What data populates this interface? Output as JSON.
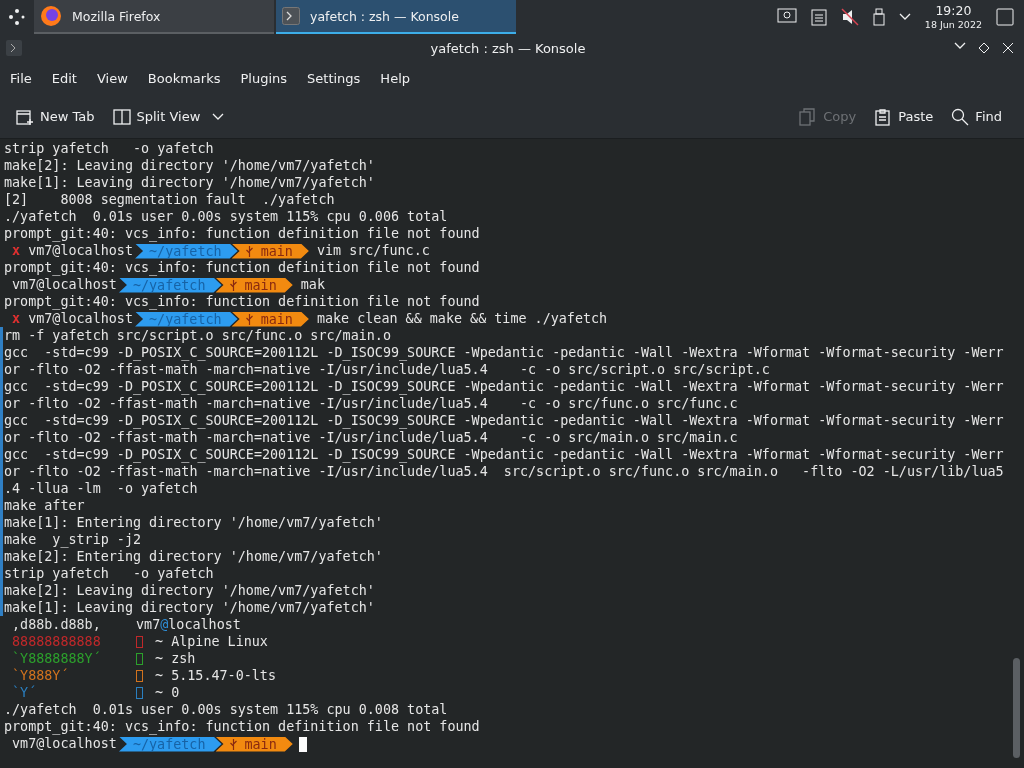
{
  "taskbar": {
    "tasks": [
      {
        "label": "Mozilla Firefox",
        "kind": "browser",
        "selected": false
      },
      {
        "label": "yafetch : zsh — Konsole",
        "kind": "terminal",
        "selected": true
      }
    ],
    "clock": {
      "time": "19:20",
      "date": "18 Jun 2022"
    }
  },
  "window": {
    "title": "yafetch : zsh — Konsole"
  },
  "menu": [
    "File",
    "Edit",
    "View",
    "Bookmarks",
    "Plugins",
    "Settings",
    "Help"
  ],
  "toolbar": {
    "left": [
      {
        "label": "New Tab",
        "kind": "newtab"
      },
      {
        "label": "Split View",
        "kind": "split"
      }
    ],
    "right": [
      {
        "label": "Copy",
        "kind": "copy",
        "disabled": true
      },
      {
        "label": "Paste",
        "kind": "paste",
        "disabled": false
      },
      {
        "label": "Find",
        "kind": "find",
        "disabled": false
      }
    ]
  },
  "terminal": {
    "lines": [
      {
        "kind": "plain",
        "text": "strip yafetch   -o yafetch",
        "marked": false
      },
      {
        "kind": "plain",
        "text": "make[2]: Leaving directory '/home/vm7/yafetch'",
        "marked": false
      },
      {
        "kind": "plain",
        "text": "make[1]: Leaving directory '/home/vm7/yafetch'",
        "marked": false
      },
      {
        "kind": "plain",
        "text": "[2]    8008 segmentation fault  ./yafetch",
        "marked": false
      },
      {
        "kind": "plain",
        "text": "./yafetch  0.01s user 0.00s system 115% cpu 0.006 total",
        "marked": false
      },
      {
        "kind": "plain",
        "text": "prompt_git:40: vcs_info: function definition file not found",
        "marked": false
      },
      {
        "kind": "prompt",
        "error": true,
        "error_mark": "x",
        "user": "vm7@localhost",
        "dir": "~/yafetch",
        "branch": "main",
        "command": "vim src/func.c",
        "cursor": false,
        "marked": false
      },
      {
        "kind": "plain",
        "text": "prompt_git:40: vcs_info: function definition file not found",
        "marked": false
      },
      {
        "kind": "prompt",
        "error": false,
        "user": "vm7@localhost",
        "dir": "~/yafetch",
        "branch": "main",
        "command": "mak",
        "cursor": false,
        "marked": false
      },
      {
        "kind": "plain",
        "text": "prompt_git:40: vcs_info: function definition file not found",
        "marked": false
      },
      {
        "kind": "prompt",
        "error": true,
        "error_mark": "x",
        "user": "vm7@localhost",
        "dir": "~/yafetch",
        "branch": "main",
        "command": "make clean && make && time ./yafetch",
        "cursor": false,
        "marked": false
      },
      {
        "kind": "plain",
        "text": "rm -f yafetch src/script.o src/func.o src/main.o",
        "marked": true
      },
      {
        "kind": "plain",
        "text": "gcc  -std=c99 -D_POSIX_C_SOURCE=200112L -D_ISOC99_SOURCE -Wpedantic -pedantic -Wall -Wextra -Wformat -Wformat-security -Werr",
        "marked": true
      },
      {
        "kind": "plain",
        "text": "or -flto -O2 -ffast-math -march=native -I/usr/include/lua5.4    -c -o src/script.o src/script.c",
        "marked": true
      },
      {
        "kind": "plain",
        "text": "gcc  -std=c99 -D_POSIX_C_SOURCE=200112L -D_ISOC99_SOURCE -Wpedantic -pedantic -Wall -Wextra -Wformat -Wformat-security -Werr",
        "marked": true
      },
      {
        "kind": "plain",
        "text": "or -flto -O2 -ffast-math -march=native -I/usr/include/lua5.4    -c -o src/func.o src/func.c",
        "marked": true
      },
      {
        "kind": "plain",
        "text": "gcc  -std=c99 -D_POSIX_C_SOURCE=200112L -D_ISOC99_SOURCE -Wpedantic -pedantic -Wall -Wextra -Wformat -Wformat-security -Werr",
        "marked": true
      },
      {
        "kind": "plain",
        "text": "or -flto -O2 -ffast-math -march=native -I/usr/include/lua5.4    -c -o src/main.o src/main.c",
        "marked": true
      },
      {
        "kind": "plain",
        "text": "gcc  -std=c99 -D_POSIX_C_SOURCE=200112L -D_ISOC99_SOURCE -Wpedantic -pedantic -Wall -Wextra -Wformat -Wformat-security -Werr",
        "marked": true
      },
      {
        "kind": "plain",
        "text": "or -flto -O2 -ffast-math -march=native -I/usr/include/lua5.4  src/script.o src/func.o src/main.o   -flto -O2 -L/usr/lib/lua5",
        "marked": true
      },
      {
        "kind": "plain",
        "text": ".4 -llua -lm  -o yafetch",
        "marked": true
      },
      {
        "kind": "plain",
        "text": "make after",
        "marked": true
      },
      {
        "kind": "plain",
        "text": "make[1]: Entering directory '/home/vm7/yafetch'",
        "marked": true
      },
      {
        "kind": "plain",
        "text": "make  y_strip -j2",
        "marked": true
      },
      {
        "kind": "plain",
        "text": "make[2]: Entering directory '/home/vm7/yafetch'",
        "marked": true
      },
      {
        "kind": "plain",
        "text": "strip yafetch   -o yafetch",
        "marked": true
      },
      {
        "kind": "plain",
        "text": "make[2]: Leaving directory '/home/vm7/yafetch'",
        "marked": true
      },
      {
        "kind": "plain",
        "text": "make[1]: Leaving directory '/home/vm7/yafetch'",
        "marked": true
      },
      {
        "kind": "fetch",
        "art": ",d88b.d88b,",
        "color": "#e0e0e0",
        "user": "vm7",
        "at": "@",
        "host": "localhost",
        "marked": false
      },
      {
        "kind": "fetch",
        "art": "88888888888",
        "color": "#c0282a",
        "info": "~ Alpine Linux",
        "marked": false
      },
      {
        "kind": "fetch",
        "art": "`Y8888888Y´",
        "color": "#2ca02c",
        "info": "~ zsh",
        "marked": false
      },
      {
        "kind": "fetch",
        "art": "`Y888Y´",
        "color": "#d2731e",
        "info": "~ 5.15.47-0-lts",
        "marked": false
      },
      {
        "kind": "fetch",
        "art": "`Y´",
        "color": "#2a7fc0",
        "info": "~ 0",
        "marked": false
      },
      {
        "kind": "plain",
        "text": "./yafetch  0.01s user 0.00s system 115% cpu 0.008 total",
        "marked": false
      },
      {
        "kind": "plain",
        "text": "prompt_git:40: vcs_info: function definition file not found",
        "marked": false
      },
      {
        "kind": "prompt",
        "error": false,
        "user": "vm7@localhost",
        "dir": "~/yafetch",
        "branch": "main",
        "cursor": true,
        "marked": false
      }
    ]
  }
}
